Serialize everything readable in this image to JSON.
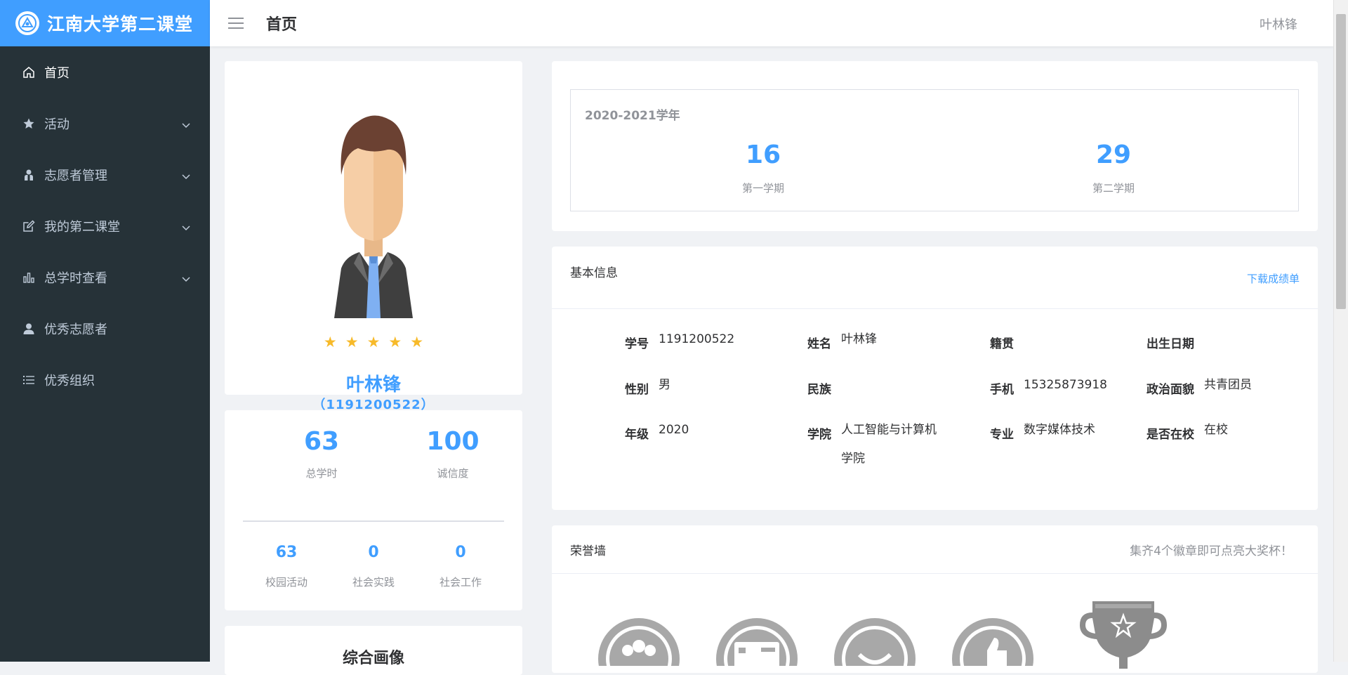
{
  "app": {
    "title": "江南大学第二课堂"
  },
  "header": {
    "page_title": "首页",
    "username": "叶林锋"
  },
  "sidebar": {
    "items": [
      {
        "label": "首页",
        "icon": "home-icon",
        "active": true,
        "has_submenu": false
      },
      {
        "label": "活动",
        "icon": "star-icon",
        "active": false,
        "has_submenu": true
      },
      {
        "label": "志愿者管理",
        "icon": "volunteer-icon",
        "active": false,
        "has_submenu": true
      },
      {
        "label": "我的第二课堂",
        "icon": "edit-icon",
        "active": false,
        "has_submenu": true
      },
      {
        "label": "总学时查看",
        "icon": "bar-chart-icon",
        "active": false,
        "has_submenu": true
      },
      {
        "label": "优秀志愿者",
        "icon": "user-icon",
        "active": false,
        "has_submenu": false
      },
      {
        "label": "优秀组织",
        "icon": "list-icon",
        "active": false,
        "has_submenu": false
      }
    ]
  },
  "profile": {
    "name": "叶林锋",
    "id_display": "（1191200522）",
    "rating": 5
  },
  "stats": {
    "total_hours": {
      "value": "63",
      "label": "总学时"
    },
    "credit": {
      "value": "100",
      "label": "诚信度"
    },
    "campus": {
      "value": "63",
      "label": "校园活动"
    },
    "practice": {
      "value": "0",
      "label": "社会实践"
    },
    "work": {
      "value": "0",
      "label": "社会工作"
    }
  },
  "portrait": {
    "title": "综合画像"
  },
  "term": {
    "year": "2020-2021学年",
    "first": {
      "value": "16",
      "label": "第一学期"
    },
    "second": {
      "value": "29",
      "label": "第二学期"
    }
  },
  "info": {
    "title": "基本信息",
    "download": "下载成绩单",
    "fields": {
      "student_id": {
        "key": "学号",
        "value": "1191200522"
      },
      "name": {
        "key": "姓名",
        "value": "叶林锋"
      },
      "native": {
        "key": "籍贯",
        "value": ""
      },
      "birth": {
        "key": "出生日期",
        "value": ""
      },
      "gender": {
        "key": "性别",
        "value": "男"
      },
      "ethnicity": {
        "key": "民族",
        "value": ""
      },
      "phone": {
        "key": "手机",
        "value": "15325873918"
      },
      "political": {
        "key": "政治面貌",
        "value": "共青团员"
      },
      "grade": {
        "key": "年级",
        "value": "2020"
      },
      "college": {
        "key": "学院",
        "value": "人工智能与计算机学院"
      },
      "major": {
        "key": "专业",
        "value": "数字媒体技术"
      },
      "enrolled": {
        "key": "是否在校",
        "value": "在校"
      }
    }
  },
  "honor": {
    "title": "荣誉墙",
    "tip": "集齐4个徽章即可点亮大奖杯！",
    "badges": [
      "group-badge-icon",
      "card-badge-icon",
      "smile-badge-icon",
      "thumbs-up-badge-icon"
    ],
    "trophy": "trophy-icon"
  },
  "colors": {
    "accent": "#409eff",
    "sidebar_bg": "#263238",
    "star": "#f7ba2a",
    "badge_gray": "#a8a8a8"
  }
}
